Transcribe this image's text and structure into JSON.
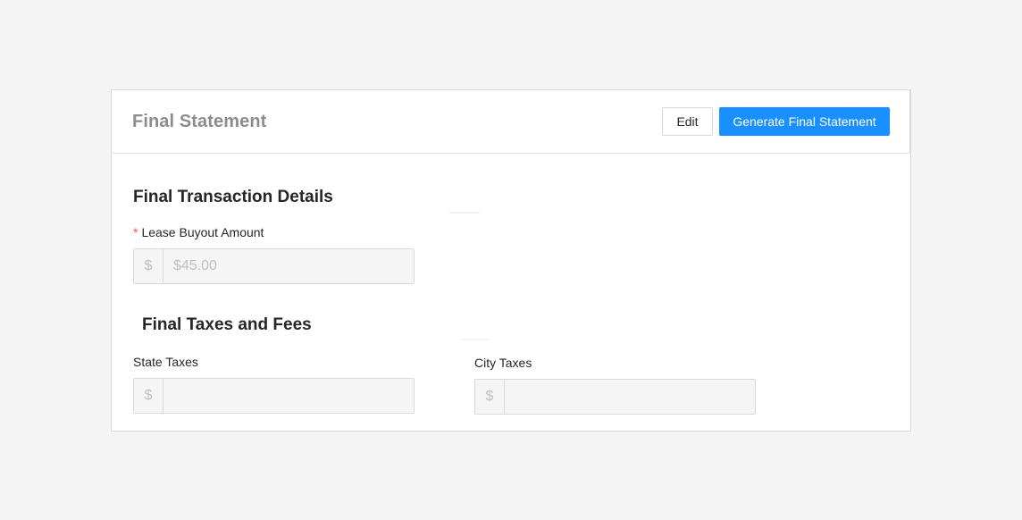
{
  "header": {
    "title": "Final Statement",
    "edit_label": "Edit",
    "generate_label": "Generate Final Statement"
  },
  "transaction": {
    "title": "Final Transaction Details",
    "lease_buyout": {
      "label": "Lease Buyout Amount",
      "required_mark": "*",
      "addon": "$",
      "value": "$45.00",
      "placeholder": ""
    }
  },
  "taxes": {
    "title": "Final Taxes and Fees",
    "state": {
      "label": "State Taxes",
      "addon": "$",
      "value": "",
      "placeholder": ""
    },
    "city": {
      "label": "City Taxes",
      "addon": "$",
      "value": "",
      "placeholder": ""
    }
  },
  "colors": {
    "primary": "#1890ff",
    "required": "#ff4d4f",
    "disabled_bg": "#f5f5f5"
  }
}
